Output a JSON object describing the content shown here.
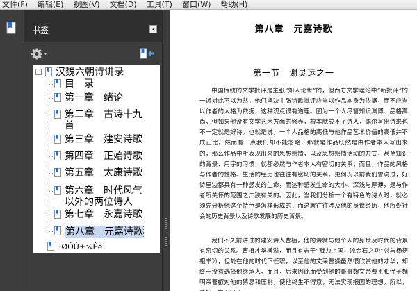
{
  "menubar": {
    "items": [
      "文件(F)",
      "编辑(E)",
      "视图(V)",
      "文档(D)",
      "工具(T)",
      "窗口(W)",
      "帮助(H)"
    ]
  },
  "left_strip": {
    "tab_icon": "bookmark-tab-icon"
  },
  "bookmarks_panel": {
    "title": "书签",
    "collapse_glyph": "◂",
    "options_icon": "gear-icon",
    "action_icon": "bookmark-action-icon",
    "tree": {
      "root": {
        "label": "汉魏六朝诗讲录",
        "expander": "−"
      },
      "children": [
        {
          "lines": [
            "目　录"
          ]
        },
        {
          "lines": [
            "第一章　绪论"
          ]
        },
        {
          "lines": [
            "第二章　古诗十九",
            "首"
          ]
        },
        {
          "lines": [
            "第三章　建安诗歌"
          ]
        },
        {
          "lines": [
            "第四章　正始诗歌"
          ]
        },
        {
          "lines": [
            "第五章　太康诗歌"
          ]
        },
        {
          "lines": [
            "第六章　时代风气",
            "以外的两位诗人"
          ]
        },
        {
          "lines": [
            "第七章　永嘉诗歌"
          ]
        },
        {
          "lines": [
            "第八章　元嘉诗歌"
          ],
          "selected": true
        }
      ],
      "extra": {
        "label": "¹ØÓÚ±¾Êé"
      }
    }
  },
  "document": {
    "chapter_title": "第八章　元嘉诗歌",
    "section_title": "第一节　谢灵运之一",
    "paragraphs": [
      "中国传统的文学批评是主张“知人论世”的，但西方文学理论中“新批评”的一派对此不以为然，他们坚决主张诗歌批评应当以作品本身为依据，而不应当以作者的人格为依据，这种观点很有道理。因为一个人尽管知识渊博、品格高尚，但如果他没有文学艺术方面的修养，根本就成不了诗人，偶尔写出诗来也不一定就是好诗。也就是说，一个人品格的高低与他作品艺术价值的高低并不成正比。然而有一点我们却不能忽略，那就是作品既然是由作者本人写出来的，那么作品中所表现出来的思想感情，以及思想感情活动的方式，甚至知识的背景、用字的习惯，就都必然与作者本人有密切的关系；而且，作品的风格与作者的性格、生活的经历也往往有密切的关系。更何况以前我们曾说过，好诗里边都具有一种感发的生命，而这种感发生命的大小、深浅与厚薄，是与作者所关怀的范围之广狭有关的。因此，当我们分析一个有特色的诗人时，就必须先分析他这个特色是怎样形成的，而这就往往涉及他的身世经历，他所处社会的历史背景以及诗歌发展的历史背景。",
      "我们不久前讲过的建安诗人曹植，他的诗就与他个人的身世及时代的背景有密切的关系。曹植才华横溢，而且有志于“戮力上国，流金石之功”（《与杨德祖书》），但处在他的时代下任职，以至他的文采曹操虽然很欣赏他的才华，却终于没有选择他继承人。而且，后来因此而受到他的哥哥魏文帝曹丕和侄子魏明帝曹叡对他的猜忌和压制，使他终生不得意，无法实现报国的理想。所以，曹植一方面写了"
    ]
  }
}
